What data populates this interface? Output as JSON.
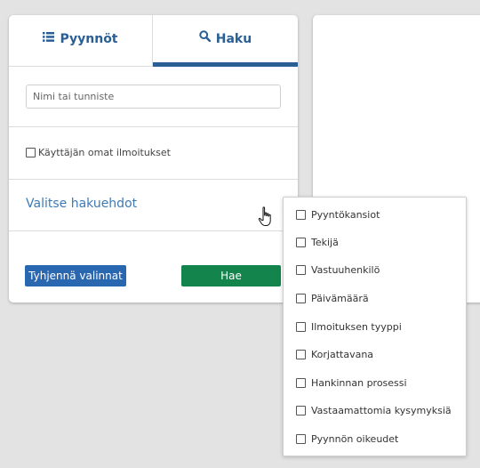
{
  "tabs": {
    "requests_label": "Pyynnöt",
    "search_label": "Haku"
  },
  "search": {
    "placeholder": "Nimi tai tunniste",
    "value": ""
  },
  "own_notifications_label": "Käyttäjän omat ilmoitukset",
  "criteria_label": "Valitse hakuehdot",
  "buttons": {
    "clear_label": "Tyhjennä valinnat",
    "search_label": "Hae"
  },
  "criteria_options": [
    {
      "label": "Pyyntökansiot",
      "checked": false
    },
    {
      "label": "Tekijä",
      "checked": false
    },
    {
      "label": "Vastuuhenkilö",
      "checked": false
    },
    {
      "label": "Päivämäärä",
      "checked": false
    },
    {
      "label": "Ilmoituksen tyyppi",
      "checked": false
    },
    {
      "label": "Korjattavana",
      "checked": false
    },
    {
      "label": "Hankinnan prosessi",
      "checked": false
    },
    {
      "label": "Vastaamattomia kysymyksiä",
      "checked": false
    },
    {
      "label": "Pyynnön oikeudet",
      "checked": false
    }
  ],
  "colors": {
    "primary_blue": "#2a5f95",
    "link_blue": "#3d7ab8",
    "clear_button": "#2a67b1",
    "search_button": "#13844b",
    "background": "#e3e3e3"
  },
  "icons": {
    "requests_tab": "list-icon",
    "search_tab": "magnifier-icon",
    "criteria_expand": "chevron-right-icon",
    "pointer": "hand-cursor-icon"
  }
}
